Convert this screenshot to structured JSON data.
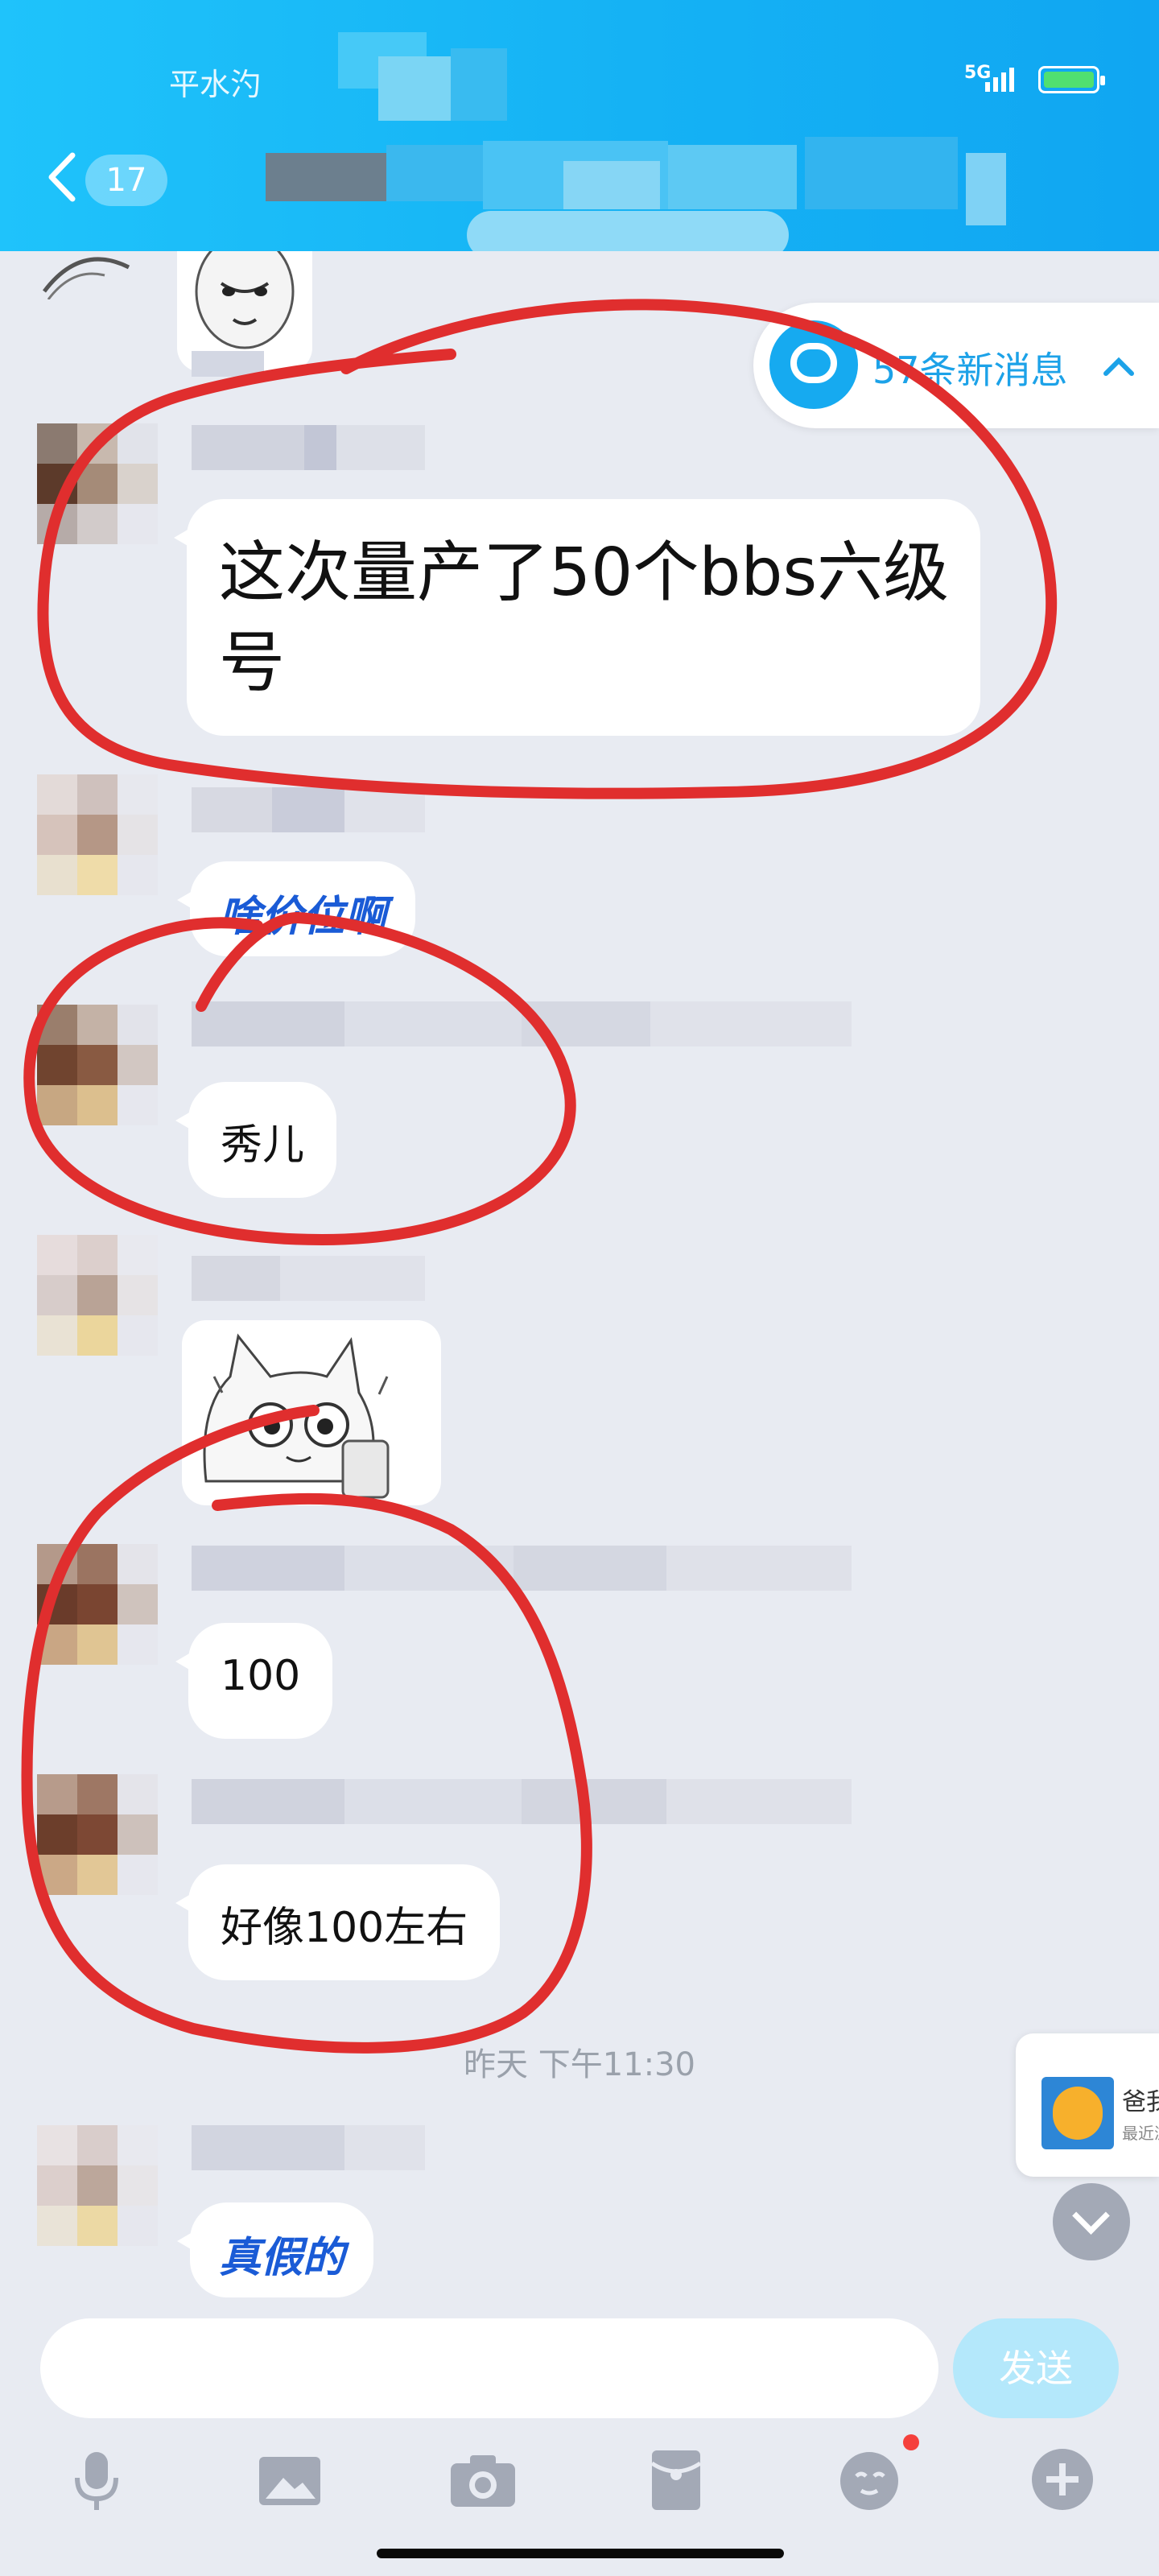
{
  "header": {
    "status_text": "平水汋",
    "network": "5G",
    "back_badge": "17"
  },
  "new_messages": {
    "label": "57条新消息"
  },
  "messages": [
    {
      "text": "这次量产了50个bbs六级号"
    },
    {
      "text": "啥价位啊"
    },
    {
      "text": "秀儿"
    },
    {
      "text": "100"
    },
    {
      "text": "好像100左右"
    },
    {
      "text": "真假的"
    }
  ],
  "timestamp": "昨天 下午11:30",
  "side_card": {
    "title": "爸我",
    "subtitle": "最近浏"
  },
  "input": {
    "placeholder": ""
  },
  "send_label": "发送",
  "toolbar": {
    "icons": [
      "microphone-icon",
      "image-icon",
      "camera-icon",
      "red-packet-icon",
      "emoji-icon",
      "plus-icon"
    ]
  },
  "colors": {
    "header_blue": "#15b2f4",
    "accent": "#1ca2e8",
    "annotation_red": "#e02e2e",
    "chat_bg": "#e8ebf2"
  }
}
